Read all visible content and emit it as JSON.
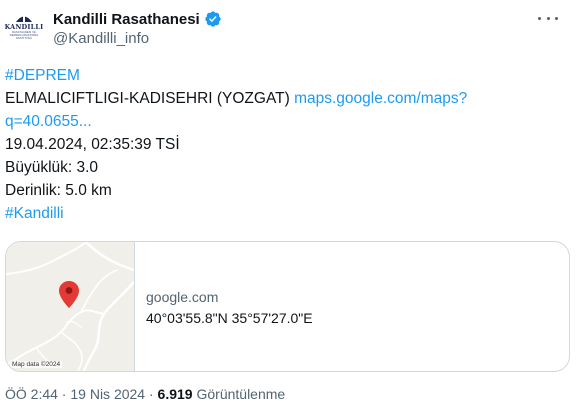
{
  "author": {
    "display_name": "Kandilli Rasathanesi",
    "handle": "@Kandilli_info",
    "avatar_logo_text": "KANDILLI",
    "avatar_logo_subtext": "RASATHANESİ VE DEPREM ARAŞTIRMA ENSTİTÜSÜ",
    "verified_icon": "verified-badge-icon",
    "more_icon": "more-options-icon"
  },
  "tweet": {
    "hashtag_1": "#DEPREM",
    "location_text": "ELMALICIFTLIGI-KADISEHRI (YOZGAT) ",
    "map_link_part1": "maps.google.com/maps?",
    "map_link_part2": "q=40.0655...",
    "datetime": "19.04.2024, 02:35:39 TSİ",
    "magnitude": "Büyüklük: 3.0",
    "depth": "Derinlik: 5.0 km",
    "hashtag_2": "#Kandilli"
  },
  "card": {
    "domain": "google.com",
    "title": "40°03'55.8\"N 35°57'27.0\"E",
    "map_credit": "Map data ©2024",
    "pin_icon": "map-pin-icon"
  },
  "meta": {
    "time": "ÖÖ 2:44",
    "separator": " · ",
    "date": "19 Nis 2024",
    "views_count": "6.919",
    "views_label": "Görüntülenme"
  },
  "colors": {
    "link": "#1d9bf0",
    "text_primary": "#0f1419",
    "text_secondary": "#536471",
    "border": "#cfd9de",
    "map_pin": "#e53935"
  }
}
